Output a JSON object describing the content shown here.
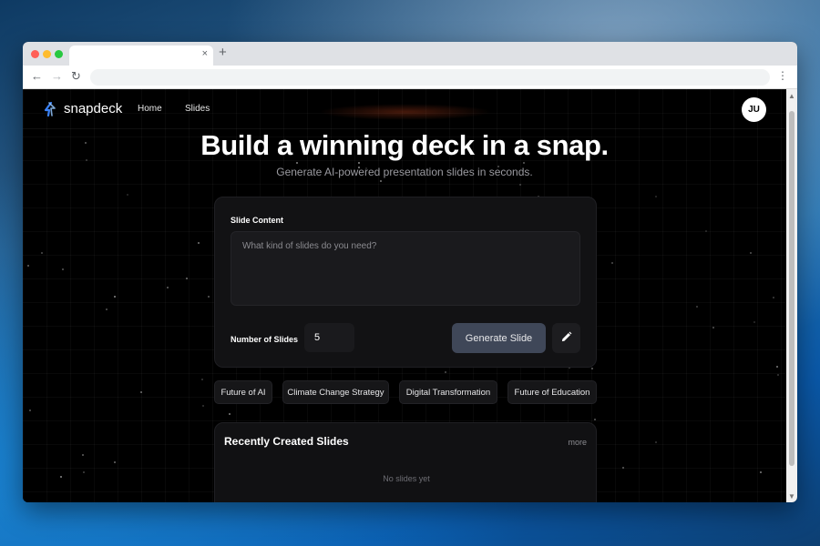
{
  "browser": {
    "tab_close": "×",
    "new_tab": "+",
    "menu": "⋮"
  },
  "header": {
    "brand": "snapdeck",
    "nav": [
      "Home",
      "Slides"
    ],
    "avatar_initials": "JU"
  },
  "hero": {
    "title": "Build a winning deck in a snap.",
    "subtitle": "Generate AI-powered presentation slides in seconds."
  },
  "form": {
    "content_label": "Slide Content",
    "content_placeholder": "What kind of slides do you need?",
    "slides_label": "Number of Slides",
    "slides_value": "5",
    "generate_label": "Generate Slide"
  },
  "suggestions": [
    "Future of AI",
    "Climate Change Strategy",
    "Digital Transformation",
    "Future of Education"
  ],
  "recent": {
    "title": "Recently Created Slides",
    "more_label": "more",
    "empty_text": "No slides yet"
  },
  "colors": {
    "logo_blue": "#3b82f6",
    "button_bg": "#3f4758"
  }
}
